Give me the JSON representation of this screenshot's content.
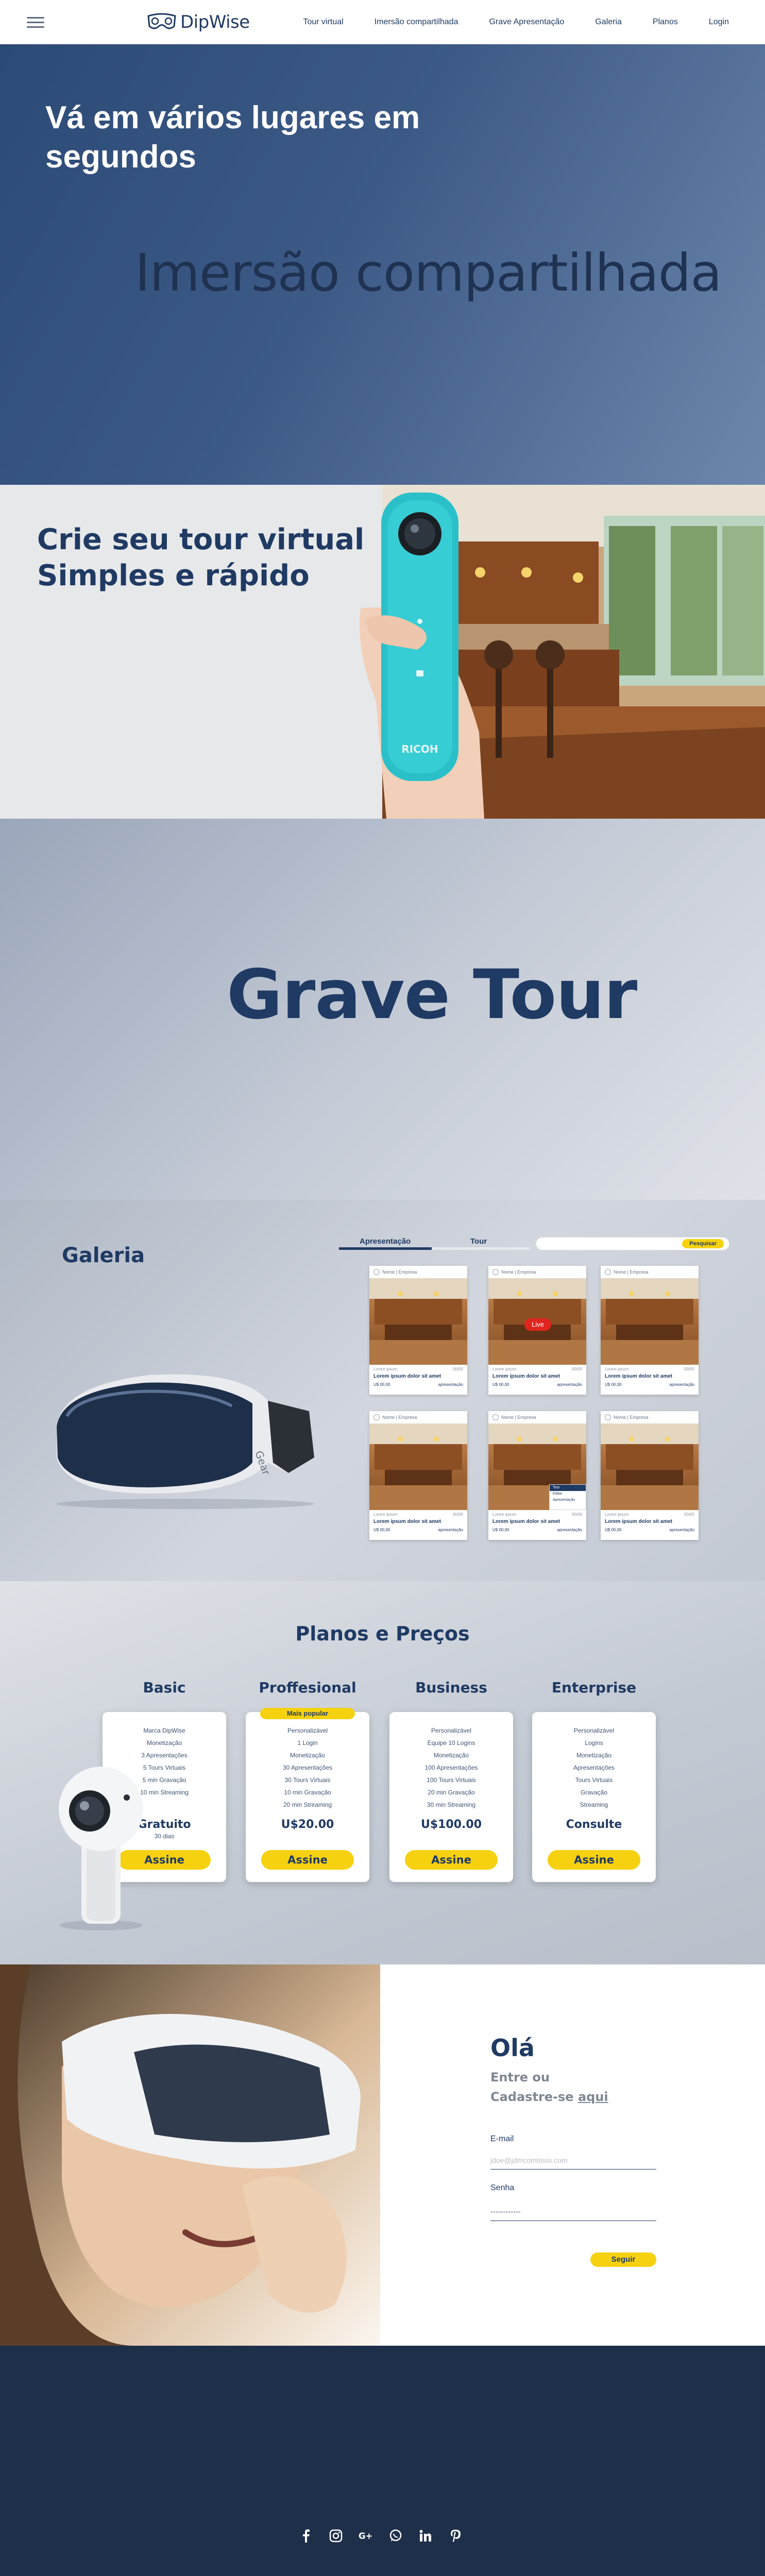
{
  "nav": {
    "brand": "DipWise",
    "links": [
      "Tour virtual",
      "Imersão compartilhada",
      "Grave Apresentação",
      "Galeria",
      "Planos",
      "Login"
    ]
  },
  "hero": {
    "title": "Vá em vários lugares em segundos",
    "subtitle": "Imersão compartilhada"
  },
  "tour_virtual": {
    "title": "Crie seu tour virtual Simples e rápido",
    "camera_brand": "RICOH"
  },
  "grave": {
    "title": "Grave Tour"
  },
  "galeria": {
    "title": "Galeria",
    "tabs": [
      "Apresentação",
      "Tour"
    ],
    "search_button": "Pesquisar",
    "cards": [
      {
        "author": "Nome | Empresa",
        "meta_left": "Lorem ipsum",
        "meta_right": "00/00",
        "title": "Lorem ipsum dolor sit amet",
        "price": "U$ 00,00",
        "action": "apresentação",
        "live": false
      },
      {
        "author": "Nome | Empresa",
        "meta_left": "Lorem ipsum",
        "meta_right": "00/00",
        "title": "Lorem ipsum dolor sit amet",
        "price": "U$ 00,00",
        "action": "apresentação",
        "live": true,
        "live_label": "Live"
      },
      {
        "author": "Nome | Empresa",
        "meta_left": "Lorem ipsum",
        "meta_right": "00/00",
        "title": "Lorem ipsum dolor sit amet",
        "price": "U$ 00,00",
        "action": "apresentação",
        "live": false
      },
      {
        "author": "Nome | Empresa",
        "meta_left": "Lorem ipsum",
        "meta_right": "00/00",
        "title": "Lorem ipsum dolor sit amet",
        "price": "U$ 00,00",
        "action": "apresentação",
        "live": false
      },
      {
        "author": "Nome | Empresa",
        "meta_left": "Lorem ipsum",
        "meta_right": "00/00",
        "title": "Lorem ipsum dolor sit amet",
        "price": "U$ 00,00",
        "action": "apresentação",
        "live": false,
        "menu": [
          "Tour",
          "Editar",
          "Apresentação"
        ]
      },
      {
        "author": "Nome | Empresa",
        "meta_left": "Lorem ipsum",
        "meta_right": "00/00",
        "title": "Lorem ipsum dolor sit amet",
        "price": "U$ 00,00",
        "action": "apresentação",
        "live": false
      }
    ]
  },
  "planos": {
    "title": "Planos e Preços",
    "plans": [
      {
        "name": "Basic",
        "features": [
          "Marca DipWise",
          "Monetização",
          "3 Apresentações",
          "5 Tours Virtuais",
          "5 min Gravação",
          "10 min Streaming"
        ],
        "price": "Gratuito",
        "period": "30 dias",
        "cta": "Assine",
        "popular": ""
      },
      {
        "name": "Proffesional",
        "features": [
          "Personalizável",
          "1 Login",
          "Monetização",
          "30 Apresentações",
          "30 Tours Virtuais",
          "10 min Gravação",
          "20 min Streaming"
        ],
        "price": "U$20.00",
        "period": "",
        "cta": "Assine",
        "popular": "Mais popular"
      },
      {
        "name": "Business",
        "features": [
          "Personalizável",
          "Equipe 10 Logins",
          "Monetização",
          "100 Apresentações",
          "100 Tours Virtuais",
          "20 min Gravação",
          "30 min Streaming"
        ],
        "price": "U$100.00",
        "period": "",
        "cta": "Assine",
        "popular": ""
      },
      {
        "name": "Enterprise",
        "features": [
          "Personalizável",
          "Logins",
          "Monetização",
          "Apresentações",
          "Tours Virtuais",
          "Gravação",
          "Streaming"
        ],
        "price": "Consulte",
        "period": "",
        "cta": "Assine",
        "popular": ""
      }
    ]
  },
  "login": {
    "hello": "Olá",
    "sub_line1": "Entre ou",
    "sub_prefix": "Cadastre-se ",
    "sub_link": "aqui",
    "email_label": "E-mail",
    "email_placeholder": "jdoe@jdmcomtosio.com",
    "password_label": "Senha",
    "password_placeholder": "••••••••••••",
    "submit": "Seguir"
  },
  "footer": {
    "social": [
      "facebook-icon",
      "instagram-icon",
      "google-plus-icon",
      "whatsapp-icon",
      "linkedin-icon",
      "pinterest-icon"
    ]
  },
  "colors": {
    "navy": "#1f3a63",
    "accent_yellow": "#f6d10f",
    "live_red": "#e0251f",
    "footer": "#1e2f4a"
  }
}
